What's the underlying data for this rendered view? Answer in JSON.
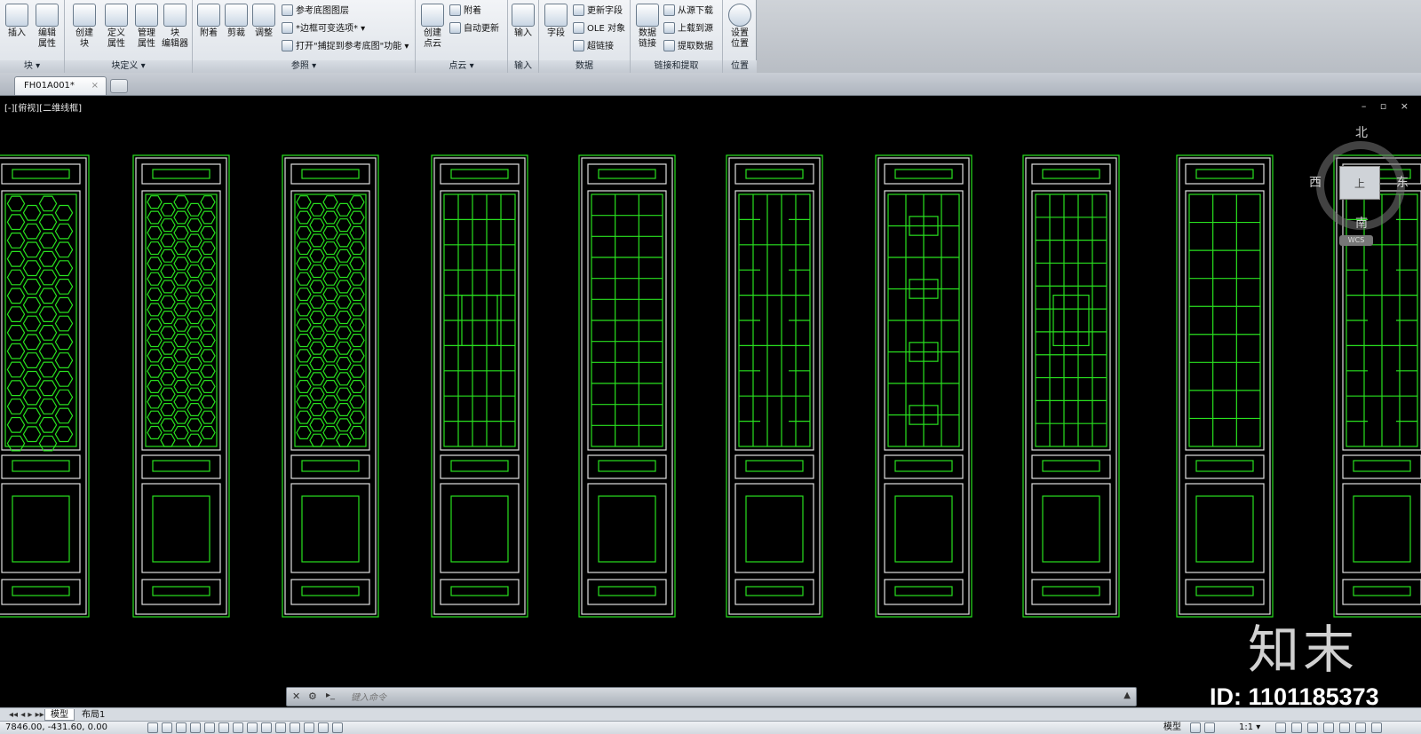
{
  "ribbon": {
    "panels": {
      "block": {
        "title": "块 ▾",
        "insert": "插入",
        "edit_attr": "编辑\n属性"
      },
      "block_def": {
        "title": "块定义 ▾",
        "create": "创建\n块",
        "define_attr": "定义\n属性",
        "manage_attr": "管理\n属性",
        "block_editor": "块\n编辑器"
      },
      "reference": {
        "title": "参照 ▾",
        "attach": "附着",
        "clip": "剪裁",
        "adjust": "调整",
        "underlay_layers": "参考底图图层",
        "frames_variable": "*边框可变选项* ▾",
        "snap_underlay": "打开\"捕捉到参考底图\"功能 ▾"
      },
      "point_cloud": {
        "title": "点云 ▾",
        "create": "创建\n点云",
        "attach": "附着",
        "auto_update": "自动更新"
      },
      "import": {
        "title": "输入",
        "import": "输入"
      },
      "data": {
        "title": "数据",
        "field": "字段",
        "update_fields": "更新字段",
        "ole_object": "OLE 对象",
        "hyperlink": "超链接"
      },
      "linking": {
        "title": "链接和提取",
        "data_link": "数据\n链接",
        "download_source": "从源下载",
        "upload_source": "上载到源",
        "extract_data": "提取数据"
      },
      "location": {
        "title": "位置",
        "set_location": "设置\n位置"
      }
    }
  },
  "tabs": {
    "document": "FH01A001*",
    "close": "×"
  },
  "viewport": {
    "label": "[-][俯视][二维线框]",
    "window_controls": "– ▫ ×",
    "viewcube": {
      "north": "北",
      "south": "南",
      "east": "东",
      "west": "西",
      "top": "上",
      "wcs": "WCS"
    },
    "line_color": "#29e11f",
    "frame_color": "#e0e0e0",
    "watermark_logo": "知末",
    "watermark_id": "ID: 1101185373"
  },
  "command": {
    "placeholder": "键入命令"
  },
  "layout_tabs": [
    "模型",
    "布局1"
  ],
  "status": {
    "coords": "7846.00, -431.60, 0.00",
    "model": "模型",
    "scale": "1:1 ▾"
  }
}
